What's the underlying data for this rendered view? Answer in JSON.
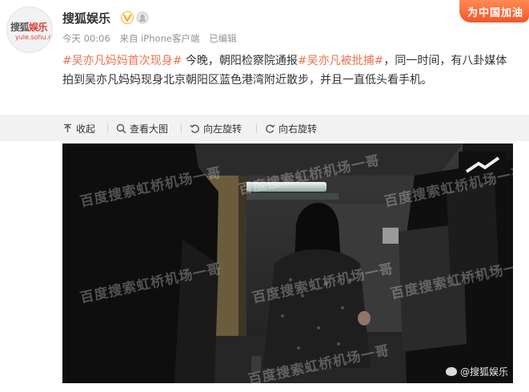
{
  "header": {
    "avatar_text_a": "搜狐",
    "avatar_text_b": "娱乐",
    "avatar_sub": "yule.sohu.com",
    "account_name": "搜狐娱乐",
    "time": "今天 00:06",
    "source": "来自 iPhone客户端",
    "edited": "已编辑",
    "promo": "为中国加油"
  },
  "post": {
    "tag1": "#吴亦凡妈妈首次现身#",
    "text1": " 今晚，朝阳检察院通报",
    "tag2": "#吴亦凡被批捕#",
    "text2": "，同一时间，有八卦媒体拍到吴亦凡妈妈现身北京朝阳区蓝色港湾附近散步，并且一直低头看手机。"
  },
  "toolbar": {
    "collapse": "收起",
    "view_large": "查看大图",
    "rotate_left": "向左旋转",
    "rotate_right": "向右旋转"
  },
  "photo": {
    "watermark": "百度搜索虹桥机场一哥",
    "credit": "@搜狐娱乐"
  },
  "colors": {
    "tag": "#eb7350",
    "verify": "#ffab1a",
    "toolbar_bg": "#f2f2f5"
  }
}
